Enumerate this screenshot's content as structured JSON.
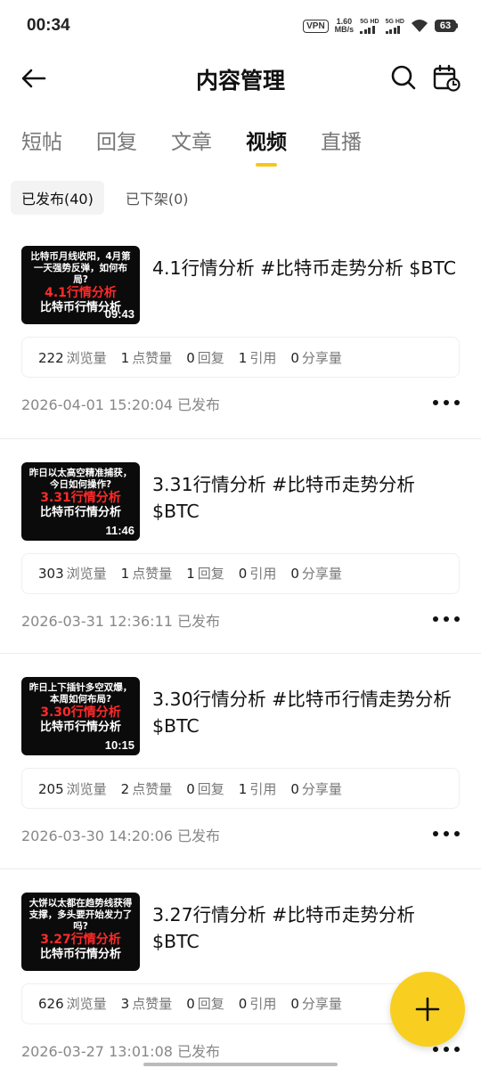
{
  "status_bar": {
    "time": "00:34",
    "vpn": "VPN",
    "speed_value": "1.60",
    "speed_unit": "MB/s",
    "sim1_label": "5G HD",
    "sim2_label": "5G HD",
    "battery": "63"
  },
  "header": {
    "title": "内容管理",
    "icons": [
      "back-arrow-icon",
      "search-icon",
      "calendar-icon"
    ]
  },
  "tabs": [
    {
      "label": "短帖",
      "active": false
    },
    {
      "label": "回复",
      "active": false
    },
    {
      "label": "文章",
      "active": false
    },
    {
      "label": "视频",
      "active": true
    },
    {
      "label": "直播",
      "active": false
    }
  ],
  "filters": [
    {
      "label": "已发布(40)",
      "active": true
    },
    {
      "label": "已下架(0)",
      "active": false
    }
  ],
  "stat_labels": {
    "views": "浏览量",
    "likes": "点赞量",
    "replies": "回复",
    "quotes": "引用",
    "shares": "分享量"
  },
  "posts": [
    {
      "thumb_top": "比特币月线收阳，4月第一天强势反弹，如何布局?",
      "thumb_red": "4.1行情分析",
      "thumb_white": "比特币行情分析",
      "duration": "09:43",
      "title": "4.1行情分析 #比特币走势分析 $BTC",
      "views": "222",
      "likes": "1",
      "replies": "0",
      "quotes": "1",
      "shares": "0",
      "date": "2026-04-01 15:20:04 已发布"
    },
    {
      "thumb_top": "昨日以太高空精准捕获，今日如何操作?",
      "thumb_red": "3.31行情分析",
      "thumb_white": "比特币行情分析",
      "duration": "11:46",
      "title": "3.31行情分析 #比特币走势分析 $BTC",
      "views": "303",
      "likes": "1",
      "replies": "1",
      "quotes": "0",
      "shares": "0",
      "date": "2026-03-31 12:36:11 已发布"
    },
    {
      "thumb_top": "昨日上下插针多空双爆，本周如何布局?",
      "thumb_red": "3.30行情分析",
      "thumb_white": "比特币行情分析",
      "duration": "10:15",
      "title": "3.30行情分析 #比特币行情走势分析 $BTC",
      "views": "205",
      "likes": "2",
      "replies": "0",
      "quotes": "1",
      "shares": "0",
      "date": "2026-03-30 14:20:06 已发布"
    },
    {
      "thumb_top": "大饼以太都在趋势线获得支撑，多头要开始发力了吗?",
      "thumb_red": "3.27行情分析",
      "thumb_white": "比特币行情分析",
      "duration": "",
      "title": "3.27行情分析 #比特币走势分析 $BTC",
      "views": "626",
      "likes": "3",
      "replies": "0",
      "quotes": "0",
      "shares": "0",
      "date": "2026-03-27 13:01:08 已发布"
    }
  ],
  "fab": {
    "icon": "plus-icon"
  },
  "colors": {
    "accent": "#f8cf20",
    "tab_underline": "#f5c71a"
  }
}
